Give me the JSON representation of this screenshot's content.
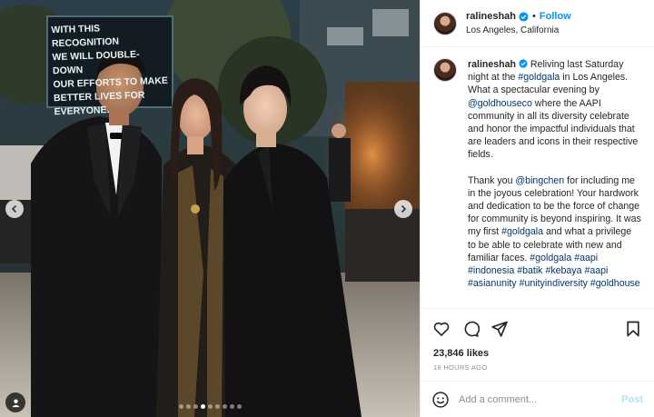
{
  "post": {
    "username": "ralineshah",
    "follow_label": "Follow",
    "separator": "•",
    "location": "Los Angeles, California",
    "verified_icon": "verified-badge-icon"
  },
  "photo": {
    "screen_text": [
      "WITH THIS RECOGNITION",
      "WE WILL DOUBLE-DOWN",
      "OUR EFFORTS TO MAKE",
      "BETTER LIVES FOR",
      "EVERYONE."
    ],
    "dot_count": 9,
    "active_dot": 3
  },
  "caption": {
    "username": "ralineshah",
    "p1_text1": "Reliving last Saturday night at the ",
    "p1_tag1": "#goldgala",
    "p1_text2": " in Los Angeles. What a spectacular evening by ",
    "p1_mention1": "@goldhouseco",
    "p1_text3": " where the AAPI community in all its diversity celebrate and honor the impactful individuals that are leaders and icons in their respective fields.",
    "p2_text1": "Thank you ",
    "p2_mention1": "@bingchen",
    "p2_text2": " for including me in the joyous celebration! Your hardwork and dedication to be the force of change for community is beyond inspiring. It was my first ",
    "p2_tag1": "#goldgala",
    "p2_text3": " and what a privilege to be able to celebrate with new and familiar faces. ",
    "tags": [
      "#goldgala",
      "#aapi",
      "#indonesia",
      "#batik",
      "#kebaya",
      "#aapi",
      "#asianunity",
      "#unityindiversity",
      "#goldhouse"
    ]
  },
  "stats": {
    "likes": "23,846 likes",
    "time": "18 HOURS AGO"
  },
  "comment": {
    "placeholder": "Add a comment...",
    "post_label": "Post"
  },
  "colors": {
    "accent": "#0095f6",
    "link": "#00376b",
    "muted": "#8e8e8e",
    "post_disabled": "#b2dffc"
  }
}
